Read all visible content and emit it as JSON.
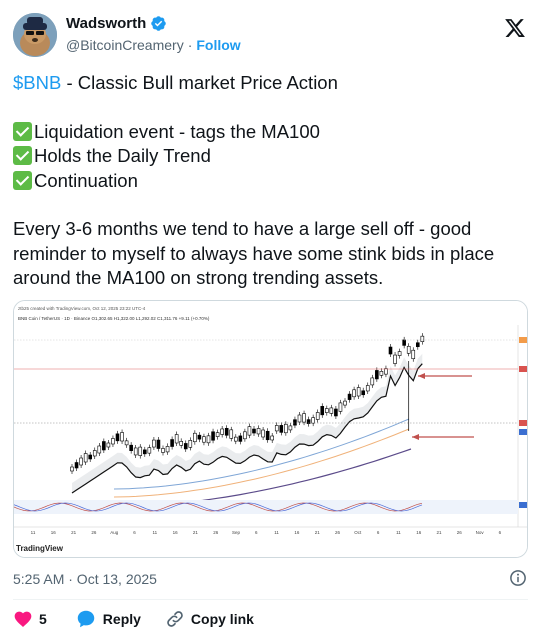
{
  "author": {
    "name": "Wadsworth",
    "handle": "@BitcoinCreamery",
    "follow_label": "Follow",
    "verified_color": "#1d9bf0"
  },
  "tweet": {
    "cashtag": "$BNB",
    "line1_rest": " - Classic Bull market Price Action",
    "checklist": [
      "Liquidation event - tags the MA100",
      "Holds the Daily Trend",
      "Continuation"
    ],
    "paragraph": "Every 3-6 months we tend to have a large sell off - good reminder to myself to always have some stink bids in place around the MA100 on strong trending assets."
  },
  "chart_image": {
    "header_text": "ztb25 created with TradingView.com, Oct 12, 2025 23:22 UTC-4",
    "symbol_text": "BNB Coin / TetherUS · 1D · Binance  O1,302.65  H1,322.00  L1,292.02  C1,311.76  +9.11 (+0.70%)",
    "x_ticks": [
      "11",
      "16",
      "21",
      "26",
      "Aug",
      "6",
      "11",
      "16",
      "21",
      "26",
      "Sep",
      "6",
      "11",
      "16",
      "21",
      "26",
      "Oct",
      "6",
      "11",
      "16",
      "21",
      "26",
      "Nov",
      "6"
    ],
    "watermark": "TradingView",
    "colors": {
      "bull": "#ffffff",
      "bear": "#000000",
      "ma_black": "#111111",
      "ma_blue": "#7fa6d6",
      "ma_orange": "#f0b27a",
      "ma_purple": "#5b4b8a",
      "hline": "#e06666",
      "arrow": "#c0504d",
      "label_red": "#d9534f",
      "label_blue": "#3b6fd1"
    }
  },
  "meta": {
    "timestamp": "5:25 AM · Oct 13, 2025"
  },
  "actions": {
    "like_count": "5",
    "reply_label": "Reply",
    "copy_label": "Copy link"
  }
}
